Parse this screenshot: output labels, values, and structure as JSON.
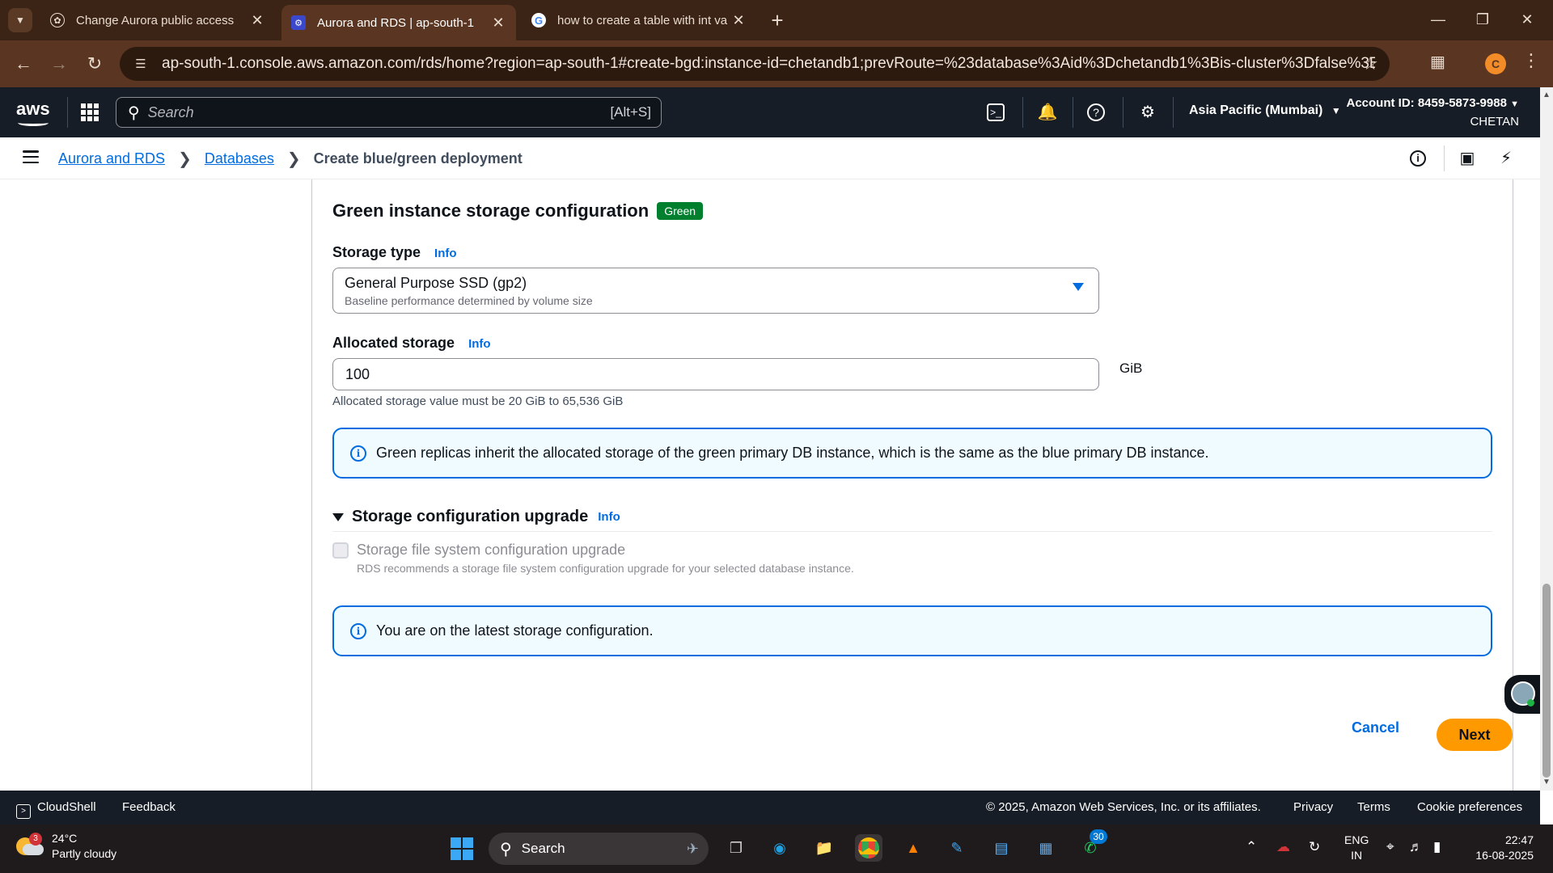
{
  "browser": {
    "tabs": [
      {
        "title": "Change Aurora public access",
        "active": false
      },
      {
        "title": "Aurora and RDS | ap-south-1",
        "active": true
      },
      {
        "title": "how to create a table with int va",
        "active": false
      }
    ],
    "url": "ap-south-1.console.aws.amazon.com/rds/home?region=ap-south-1#create-bgd:instance-id=chetandb1;prevRoute=%23database%3Aid%3Dchetandb1%3Bis-cluster%3Dfalse%3Btab%3Dconne...",
    "profile_initial": "C"
  },
  "aws_nav": {
    "logo_text": "aws",
    "search_placeholder": "Search",
    "search_shortcut": "[Alt+S]",
    "region": "Asia Pacific (Mumbai)",
    "account_id": "Account ID: 8459-5873-9988",
    "account_name": "CHETAN"
  },
  "breadcrumb": {
    "items": [
      "Aurora and RDS",
      "Databases"
    ],
    "current": "Create blue/green deployment"
  },
  "main": {
    "section_title": "Green instance storage configuration",
    "section_badge": "Green",
    "storage_type_label": "Storage type",
    "info_label": "Info",
    "storage_type_value": "General Purpose SSD (gp2)",
    "storage_type_desc": "Baseline performance determined by volume size",
    "allocated_label": "Allocated storage",
    "allocated_value": "100",
    "allocated_unit": "GiB",
    "allocated_hint": "Allocated storage value must be 20 GiB to 65,536 GiB",
    "replica_alert": "Green replicas inherit the allocated storage of the green primary DB instance, which is the same as the blue primary DB instance.",
    "upgrade_section_title": "Storage configuration upgrade",
    "upgrade_checkbox_label": "Storage file system configuration upgrade",
    "upgrade_checkbox_desc": "RDS recommends a storage file system configuration upgrade for your selected database instance.",
    "upgrade_checked": false,
    "latest_alert": "You are on the latest storage configuration.",
    "cancel_label": "Cancel",
    "next_label": "Next"
  },
  "footer": {
    "cloudshell": "CloudShell",
    "feedback": "Feedback",
    "copyright": "© 2025, Amazon Web Services, Inc. or its affiliates.",
    "privacy": "Privacy",
    "terms": "Terms",
    "cookie": "Cookie preferences"
  },
  "taskbar": {
    "weather_badge": "3",
    "temperature": "24°C",
    "condition": "Partly cloudy",
    "search_label": "Search",
    "whatsapp_badge": "30",
    "lang_top": "ENG",
    "lang_bottom": "IN",
    "time": "22:47",
    "date": "16-08-2025"
  },
  "colors": {
    "accent_blue": "#006ce0",
    "primary_button": "#ff9900",
    "green_badge": "#00802f",
    "aws_nav_bg": "#161d26"
  }
}
